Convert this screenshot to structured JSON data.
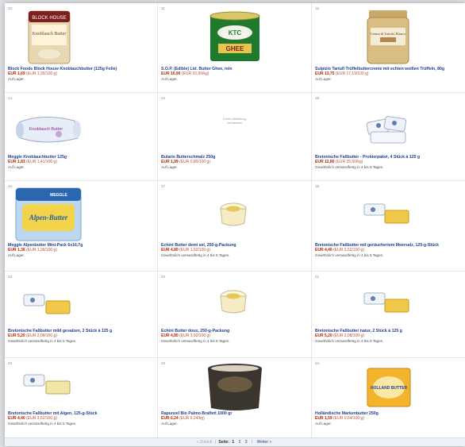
{
  "products": [
    {
      "number": "10.",
      "title": "Block Foods Block House Knoblauchbutter (125g Folie)",
      "price": "EUR 1,69",
      "unit_price": "(EUR 1,35/100 g)",
      "availability": "Auf Lager.",
      "image": "jar-knoblauch"
    },
    {
      "number": "11.",
      "title": "S.O.P. (Edible) Ltd. Butter Ghee, rein",
      "price": "EUR 10,90",
      "unit_price": "(EUR 10,90/kg)",
      "availability": "Auf Lager.",
      "image": "ghee-tin"
    },
    {
      "number": "12.",
      "title": "Sulpizio Tartufi Trüffelbuttercreme mit echten weißen Trüffeln, 80g",
      "price": "EUR 13,75",
      "unit_price": "(EUR 17,19/100 g)",
      "availability": "Auf Lager.",
      "image": "truffle-jar"
    },
    {
      "number": "13.",
      "title": "Meggle Knoblauchbutter 125g",
      "price": "EUR 1,83",
      "unit_price": "(EUR 1,41/100 g)",
      "availability": "Auf Lager.",
      "image": "butter-roll"
    },
    {
      "number": "14.",
      "title": "Butaris Butterschmalz 250g",
      "price": "EUR 1,99",
      "unit_price": "(EUR 0,80/100 g)",
      "availability": "Auf Lager.",
      "image": "no-image",
      "noimg": "Keine Abbildung vorhanden"
    },
    {
      "number": "15.",
      "title": "Bretonische Faßbutter - Probierpaket, 4 Stück à 125 g",
      "price": "EUR 12,80",
      "unit_price": "(EUR 25,60/kg)",
      "availability": "Gewöhnlich versandfertig in 4 bis 5 Tagen.",
      "image": "butter-pack"
    },
    {
      "number": "16.",
      "title": "Meggle Alpenbutter Mini-Pack 6x16,7g",
      "price": "EUR 1,36",
      "unit_price": "(EUR 1,36/100 g)",
      "availability": "Auf Lager.",
      "image": "alpen-pack"
    },
    {
      "number": "17.",
      "title": "Echiré Butter demi sel, 250-g-Packung",
      "price": "EUR 4,80",
      "unit_price": "(EUR 1,92/100 g)",
      "availability": "Gewöhnlich versandfertig in 4 bis 5 Tagen.",
      "image": "echire-tub"
    },
    {
      "number": "18.",
      "title": "Bretonische Faßbutter mit geräuchertem Meersalz, 125-g-Stück",
      "price": "EUR 4,40",
      "unit_price": "(EUR 3,52/100 g)",
      "availability": "Gewöhnlich versandfertig in 4 bis 5 Tagen.",
      "image": "butter-pack"
    },
    {
      "number": "19.",
      "title": "Bretonische Faßbutter mild gesalzen, 2 Stück à 125 g",
      "price": "EUR 5,20",
      "unit_price": "(EUR 2,08/100 g)",
      "availability": "Gewöhnlich versandfertig in 4 bis 5 Tagen.",
      "image": "butter-pack"
    },
    {
      "number": "20.",
      "title": "Echiré Butter doux, 250-g-Packung",
      "price": "EUR 4,80",
      "unit_price": "(EUR 1,92/100 g)",
      "availability": "Gewöhnlich versandfertig in 4 bis 5 Tagen.",
      "image": "echire-tub"
    },
    {
      "number": "21.",
      "title": "Bretonische Faßbutter natur, 2 Stück à 125 g",
      "price": "EUR 5,20",
      "unit_price": "(EUR 2,08/100 g)",
      "availability": "Gewöhnlich versandfertig in 4 bis 5 Tagen.",
      "image": "butter-pack"
    },
    {
      "number": "22.",
      "title": "Bretonische Faßbutter mit Algen, 125-g-Stück",
      "price": "EUR 4,40",
      "unit_price": "(EUR 3,52/100 g)",
      "availability": "Gewöhnlich versandfertig in 4 bis 5 Tagen.",
      "image": "butter-pack"
    },
    {
      "number": "23.",
      "title": "Rapunzel Bio Palmo Bratfett 1000 gr",
      "price": "EUR 6,24",
      "unit_price": "(EUR 6,24/kg)",
      "availability": "Auf Lager.",
      "image": "bucket"
    },
    {
      "number": "24.",
      "title": "Holländische Markenbutter 250g",
      "price": "EUR 1,59",
      "unit_price": "(EUR 0,64/100 g)",
      "availability": "Auf Lager.",
      "image": "dutch-butter"
    }
  ],
  "pagination": {
    "prev": "« Zurück",
    "label": "Seite:",
    "pages": [
      "1",
      "2",
      "3"
    ],
    "next": "Weiter »"
  },
  "labels": {
    "jar_brand": "BLOCK HOUSE",
    "jar_product": "Knoblauch Butter",
    "ghee_brand": "KTC",
    "ghee_word": "GHEE",
    "truffle_text": "Crema di Tartufo Bianco",
    "roll_text": "Knoblauch Butter",
    "alpen_brand": "MEGGLE",
    "alpen_text": "Alpen-Butter",
    "dutch_text": "HOLLAND BUTTER"
  }
}
